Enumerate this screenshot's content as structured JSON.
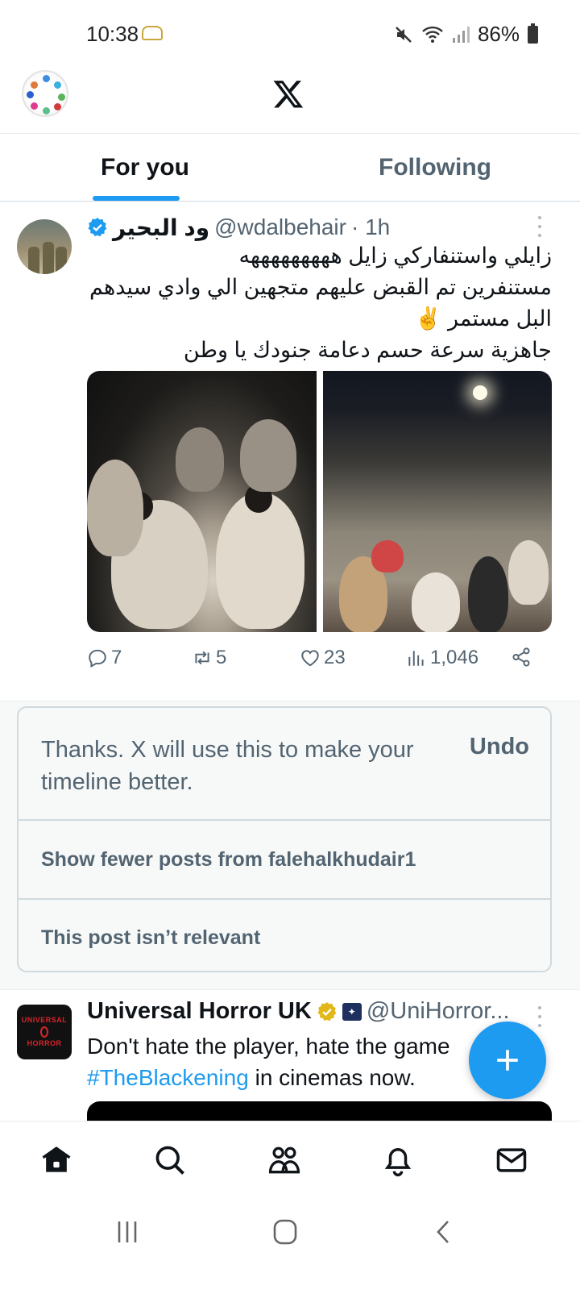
{
  "status_bar": {
    "time": "10:38",
    "battery": "86%"
  },
  "tabs": [
    {
      "label": "For you",
      "active": true
    },
    {
      "label": "Following",
      "active": false
    }
  ],
  "tweet1": {
    "name": "ود البحير",
    "handle": "@wdalbehair",
    "time": "· 1h",
    "text_lines": [
      "زايلي واستنفاركي زايل هههههههههه",
      "مستنفرين تم القبض عليهم  متجهين الي وادي سيدهم",
      "البل مستمر ✌️",
      "جاهزية سرعة حسم دعامة جنودك يا وطن"
    ],
    "replies": "7",
    "reposts": "5",
    "likes": "23",
    "views": "1,046"
  },
  "feedback": {
    "message": "Thanks. X will use this to make your timeline better.",
    "undo": "Undo",
    "option1": "Show fewer posts from falehalkhudair1",
    "option2": "This post isn’t relevant"
  },
  "tweet2": {
    "name": "Universal Horror UK",
    "handle": "@UniHorror...",
    "avatar_lines": [
      "UNIVERSAL",
      "HORROR"
    ],
    "text_line1": "Don't hate the player, hate the game",
    "hashtag": "#TheBlackening",
    "text_rest": " in cinemas now."
  },
  "colors": {
    "accent": "#1d9bf0",
    "text_primary": "#0f1419",
    "text_secondary": "#536471",
    "border": "#cfd9de",
    "gold_badge": "#e2b719"
  },
  "icons": {
    "bottom_nav": [
      "home-icon",
      "search-icon",
      "communities-icon",
      "notifications-icon",
      "messages-icon"
    ],
    "system_nav": [
      "recents-icon",
      "home-circle-icon",
      "back-icon"
    ]
  }
}
